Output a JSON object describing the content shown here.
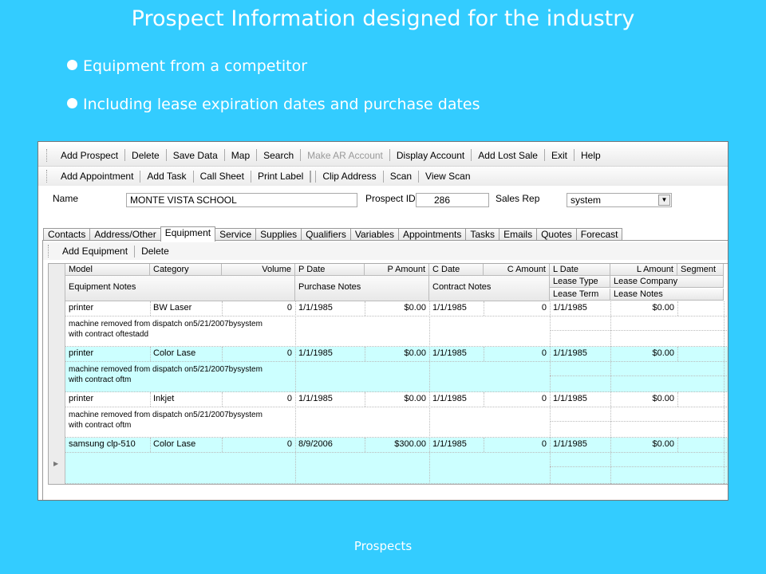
{
  "slide": {
    "title": "Prospect Information designed for the industry",
    "bullets": [
      "Equipment from a competitor",
      "Including lease expiration dates and purchase dates"
    ],
    "footer": "Prospects"
  },
  "toolbar1": [
    "Add Prospect",
    "Delete",
    "Save Data",
    "Map",
    "Search",
    "Make AR Account",
    "Display Account",
    "Add Lost Sale",
    "Exit",
    "Help"
  ],
  "toolbar1_disabled": [
    "Make AR Account"
  ],
  "toolbar2": [
    "Add Appointment",
    "Add Task",
    "Call Sheet",
    "Print Label",
    "Clip Address",
    "Scan",
    "View Scan"
  ],
  "form": {
    "name_label": "Name",
    "name_value": "MONTE VISTA SCHOOL",
    "prospect_id_label": "Prospect ID",
    "prospect_id_value": "286",
    "sales_rep_label": "Sales Rep",
    "sales_rep_value": "system"
  },
  "tabs": [
    "Contacts",
    "Address/Other",
    "Equipment",
    "Service",
    "Supplies",
    "Qualifiers",
    "Variables",
    "Appointments",
    "Tasks",
    "Emails",
    "Quotes",
    "Forecast"
  ],
  "active_tab": "Equipment",
  "equipment_toolbar": [
    "Add Equipment",
    "Delete"
  ],
  "grid": {
    "headers_row1": [
      "Model",
      "Category",
      "Volume",
      "P Date",
      "P Amount",
      "C Date",
      "C Amount",
      "L Date",
      "L Amount",
      "Segment"
    ],
    "headers_row2": [
      "Equipment Notes",
      "Purchase Notes",
      "Contract Notes",
      "Lease Type",
      "Lease Company"
    ],
    "headers_row3": [
      "Lease Term",
      "Lease Notes"
    ],
    "rows": [
      {
        "model": "printer",
        "category": "BW Laser",
        "volume": "0",
        "p_date": "1/1/1985",
        "p_amount": "$0.00",
        "c_date": "1/1/1985",
        "c_amount": "0",
        "l_date": "1/1/1985",
        "l_amount": "$0.00",
        "notes": [
          "machine removed from dispatch on5/21/2007bysystem",
          "with contract oftestadd"
        ]
      },
      {
        "model": "printer",
        "category": "Color Lase",
        "volume": "0",
        "p_date": "1/1/1985",
        "p_amount": "$0.00",
        "c_date": "1/1/1985",
        "c_amount": "0",
        "l_date": "1/1/1985",
        "l_amount": "$0.00",
        "notes": [
          "machine removed from dispatch on5/21/2007bysystem",
          "with contract oftm"
        ]
      },
      {
        "model": "printer",
        "category": "Inkjet",
        "volume": "0",
        "p_date": "1/1/1985",
        "p_amount": "$0.00",
        "c_date": "1/1/1985",
        "c_amount": "0",
        "l_date": "1/1/1985",
        "l_amount": "$0.00",
        "notes": [
          "machine removed from dispatch on5/21/2007bysystem",
          "with contract oftm"
        ]
      },
      {
        "model": "samsung clp-510",
        "category": "Color Lase",
        "volume": "0",
        "p_date": "8/9/2006",
        "p_amount": "$300.00",
        "c_date": "1/1/1985",
        "c_amount": "0",
        "l_date": "1/1/1985",
        "l_amount": "$0.00",
        "notes": [
          "",
          ""
        ]
      }
    ]
  },
  "colors": {
    "background": "#33ccff",
    "alt_row": "#ccffff"
  }
}
